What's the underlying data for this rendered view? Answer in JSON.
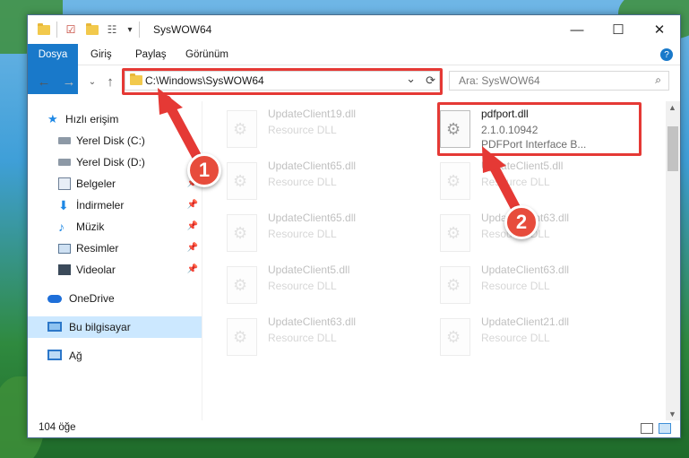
{
  "window": {
    "title": "SysWOW64",
    "minimize_label": "—",
    "maximize_label": "☐",
    "close_label": "✕"
  },
  "ribbon": {
    "tabs": [
      "Dosya",
      "Giriş",
      "Paylaş",
      "Görünüm"
    ],
    "help": "?"
  },
  "address": {
    "path": "C:\\Windows\\SysWOW64",
    "dropdown": "⌄",
    "refresh": "⟳"
  },
  "search": {
    "placeholder": "Ara: SysWOW64"
  },
  "sidebar": {
    "items": [
      {
        "label": "Hızlı erişim",
        "icon": "star-icon"
      },
      {
        "label": "Yerel Disk (C:)",
        "icon": "drive-icon"
      },
      {
        "label": "Yerel Disk (D:)",
        "icon": "drive-icon"
      },
      {
        "label": "Belgeler",
        "icon": "documents-icon"
      },
      {
        "label": "İndirmeler",
        "icon": "download-icon"
      },
      {
        "label": "Müzik",
        "icon": "music-icon"
      },
      {
        "label": "Resimler",
        "icon": "pictures-icon"
      },
      {
        "label": "Videolar",
        "icon": "video-icon"
      },
      {
        "label": "OneDrive",
        "icon": "cloud-icon"
      },
      {
        "label": "Bu bilgisayar",
        "icon": "computer-icon"
      },
      {
        "label": "Ağ",
        "icon": "network-icon"
      }
    ]
  },
  "files": {
    "highlight": {
      "name": "pdfport.dll",
      "version": "2.1.0.10942",
      "desc": "PDFPort Interface B..."
    },
    "left": [
      {
        "name": "UpdateClient19.dll",
        "desc": "Resource DLL"
      },
      {
        "name": "UpdateClient65.dll",
        "desc": "Resource DLL"
      },
      {
        "name": "UpdateClient65.dll",
        "desc": "Resource DLL"
      },
      {
        "name": "UpdateClient5.dll",
        "desc": "Resource DLL"
      },
      {
        "name": "UpdateClient63.dll",
        "desc": "Resource DLL"
      }
    ],
    "right": [
      {
        "name": "UpdateClient5.dll",
        "desc": "Resource DLL"
      },
      {
        "name": "UpdateClient63.dll",
        "desc": "Resource DLL"
      },
      {
        "name": "UpdateClient63.dll",
        "desc": "Resource DLL"
      },
      {
        "name": "UpdateClient21.dll",
        "desc": "Resource DLL"
      }
    ]
  },
  "status": {
    "count": "104 öğe"
  },
  "annotations": {
    "step1": "1",
    "step2": "2"
  },
  "colors": {
    "accent": "#1979ca",
    "highlight": "#e53935",
    "selected": "#cce8ff"
  }
}
